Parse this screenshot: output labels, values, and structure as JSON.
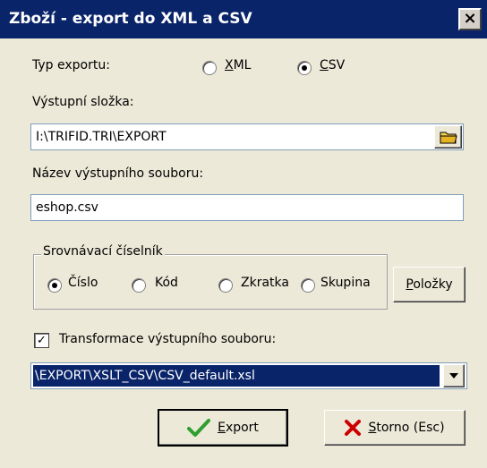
{
  "window": {
    "title": "Zboží - export do XML a CSV",
    "close_label": "×"
  },
  "export_type": {
    "label": "Typ exportu:",
    "options": [
      {
        "key": "X",
        "rest": "ML",
        "checked": false
      },
      {
        "key": "C",
        "rest": "SV",
        "checked": true
      }
    ]
  },
  "output_folder": {
    "label": "Výstupní složka:",
    "value": "I:\\TRIFID.TRI\\EXPORT"
  },
  "output_file": {
    "label": "Název výstupního souboru:",
    "value": "eshop.csv"
  },
  "comparison": {
    "label": "Srovnávací číselník",
    "options": [
      {
        "label": "Číslo",
        "checked": true
      },
      {
        "label": "Kód",
        "checked": false
      },
      {
        "label": "Zkratka",
        "checked": false
      },
      {
        "label": "Skupina",
        "checked": false
      }
    ],
    "items_button": {
      "key": "P",
      "rest": "oložky"
    }
  },
  "transform": {
    "label": "Transformace výstupního souboru:",
    "checked": true,
    "check_mark": "✓",
    "value": "\\EXPORT\\XSLT_CSV\\CSV_default.xsl"
  },
  "buttons": {
    "export": {
      "key": "E",
      "rest": "xport"
    },
    "cancel": {
      "key": "S",
      "rest": "torno (Esc)"
    }
  },
  "colors": {
    "titlebar": "#0a246a",
    "selection": "#0a246a",
    "dialog_bg": "#ece9d8"
  }
}
